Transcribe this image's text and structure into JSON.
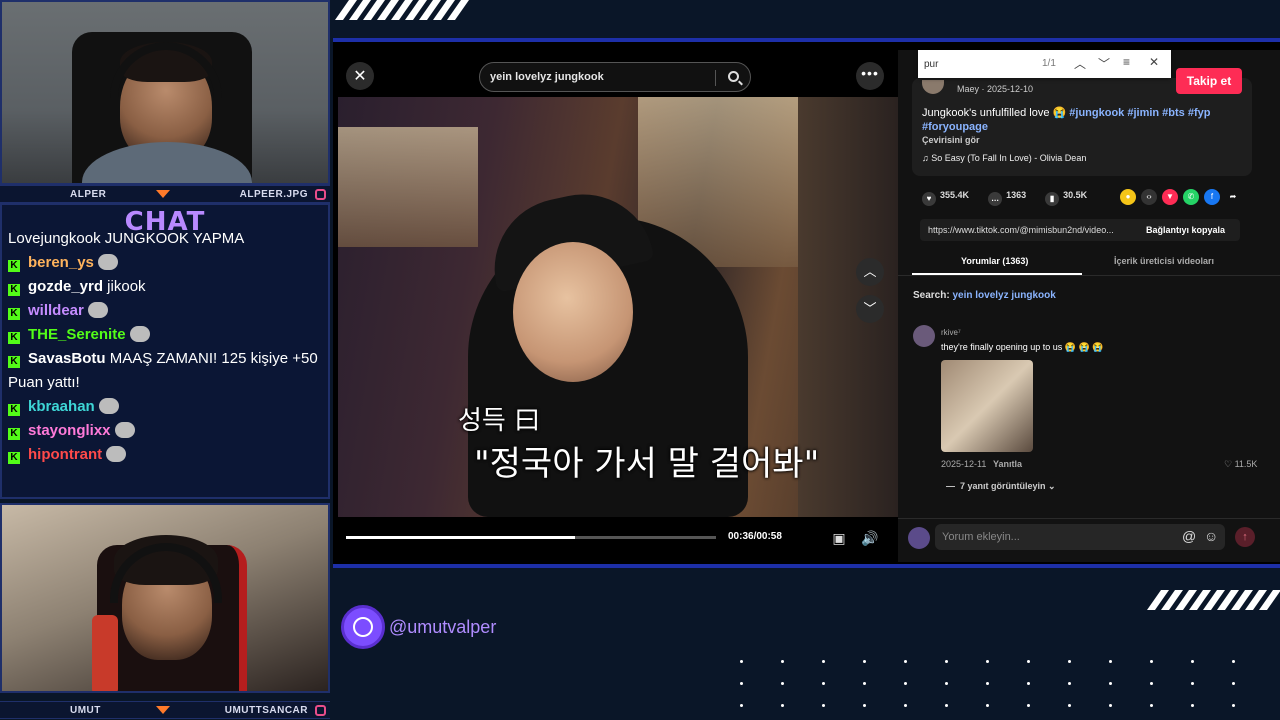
{
  "overlay": {
    "top_cam": {
      "name": "ALPER",
      "handle": "ALPEER.JPG"
    },
    "bottom_cam": {
      "name": "UMUT",
      "handle": "UMUTTSANCAR"
    },
    "chat_title": "CHAT",
    "chat_messages": [
      {
        "user": "",
        "text": "Lovejungkook JUNGKOOK YAPMA",
        "color": "#ffffff"
      },
      {
        "user": "beren_ys",
        "text": "",
        "color": "#ffb35c"
      },
      {
        "user": "gozde_yrd",
        "text": "jikook",
        "color": "#ffffff"
      },
      {
        "user": "willdear",
        "text": "",
        "color": "#c58cff"
      },
      {
        "user": "THE_Serenite",
        "text": "",
        "color": "#53fc18"
      },
      {
        "user": "SavasBotu",
        "text": "MAAŞ ZAMANI! 125 kişiye +50 Puan yattı!",
        "color": "#ffffff"
      },
      {
        "user": "kbraahan",
        "text": "",
        "color": "#3ed6d6"
      },
      {
        "user": "stayonglixx",
        "text": "",
        "color": "#ff7ad9"
      },
      {
        "user": "hipontrant",
        "text": "",
        "color": "#ff4a4a"
      }
    ],
    "social_handle": "@umutvalper"
  },
  "tiktok": {
    "search_query": "yein lovelyz jungkook",
    "subtitle_line1": "성득 曰",
    "subtitle_line2": "\"정국아 가서 말 걸어봐\"",
    "time": "00:36/00:58",
    "progress": 0.62,
    "find": {
      "query": "pur",
      "count": "1/1"
    },
    "follow_label": "Takip et",
    "author": "Maey · 2025-12-10",
    "caption_text": "Jungkook's unfulfilled love 😭",
    "caption_tags": "#jungkook #jimin #bts #fyp #foryoupage",
    "translate_label": "Çevirisini gör",
    "music": "So Easy (To Fall In Love) - Olivia Dean",
    "likes": "355.4K",
    "comments": "1363",
    "saves": "30.5K",
    "url": "https://www.tiktok.com/@mimisbun2nd/video...",
    "copy_link": "Bağlantıyı kopyala",
    "tab_comments": "Yorumlar (1363)",
    "tab_creator": "İçerik üreticisi videoları",
    "search_prefix": "Search:",
    "search_related": "yein lovelyz jungkook",
    "comment": {
      "user": "rkive⁷",
      "text": "they're finally opening up to us",
      "date": "2025-12-11",
      "reply": "Yanıtla",
      "likes": "11.5K",
      "more_replies": "7 yanıt görüntüleyin"
    },
    "comment_placeholder": "Yorum ekleyin..."
  }
}
